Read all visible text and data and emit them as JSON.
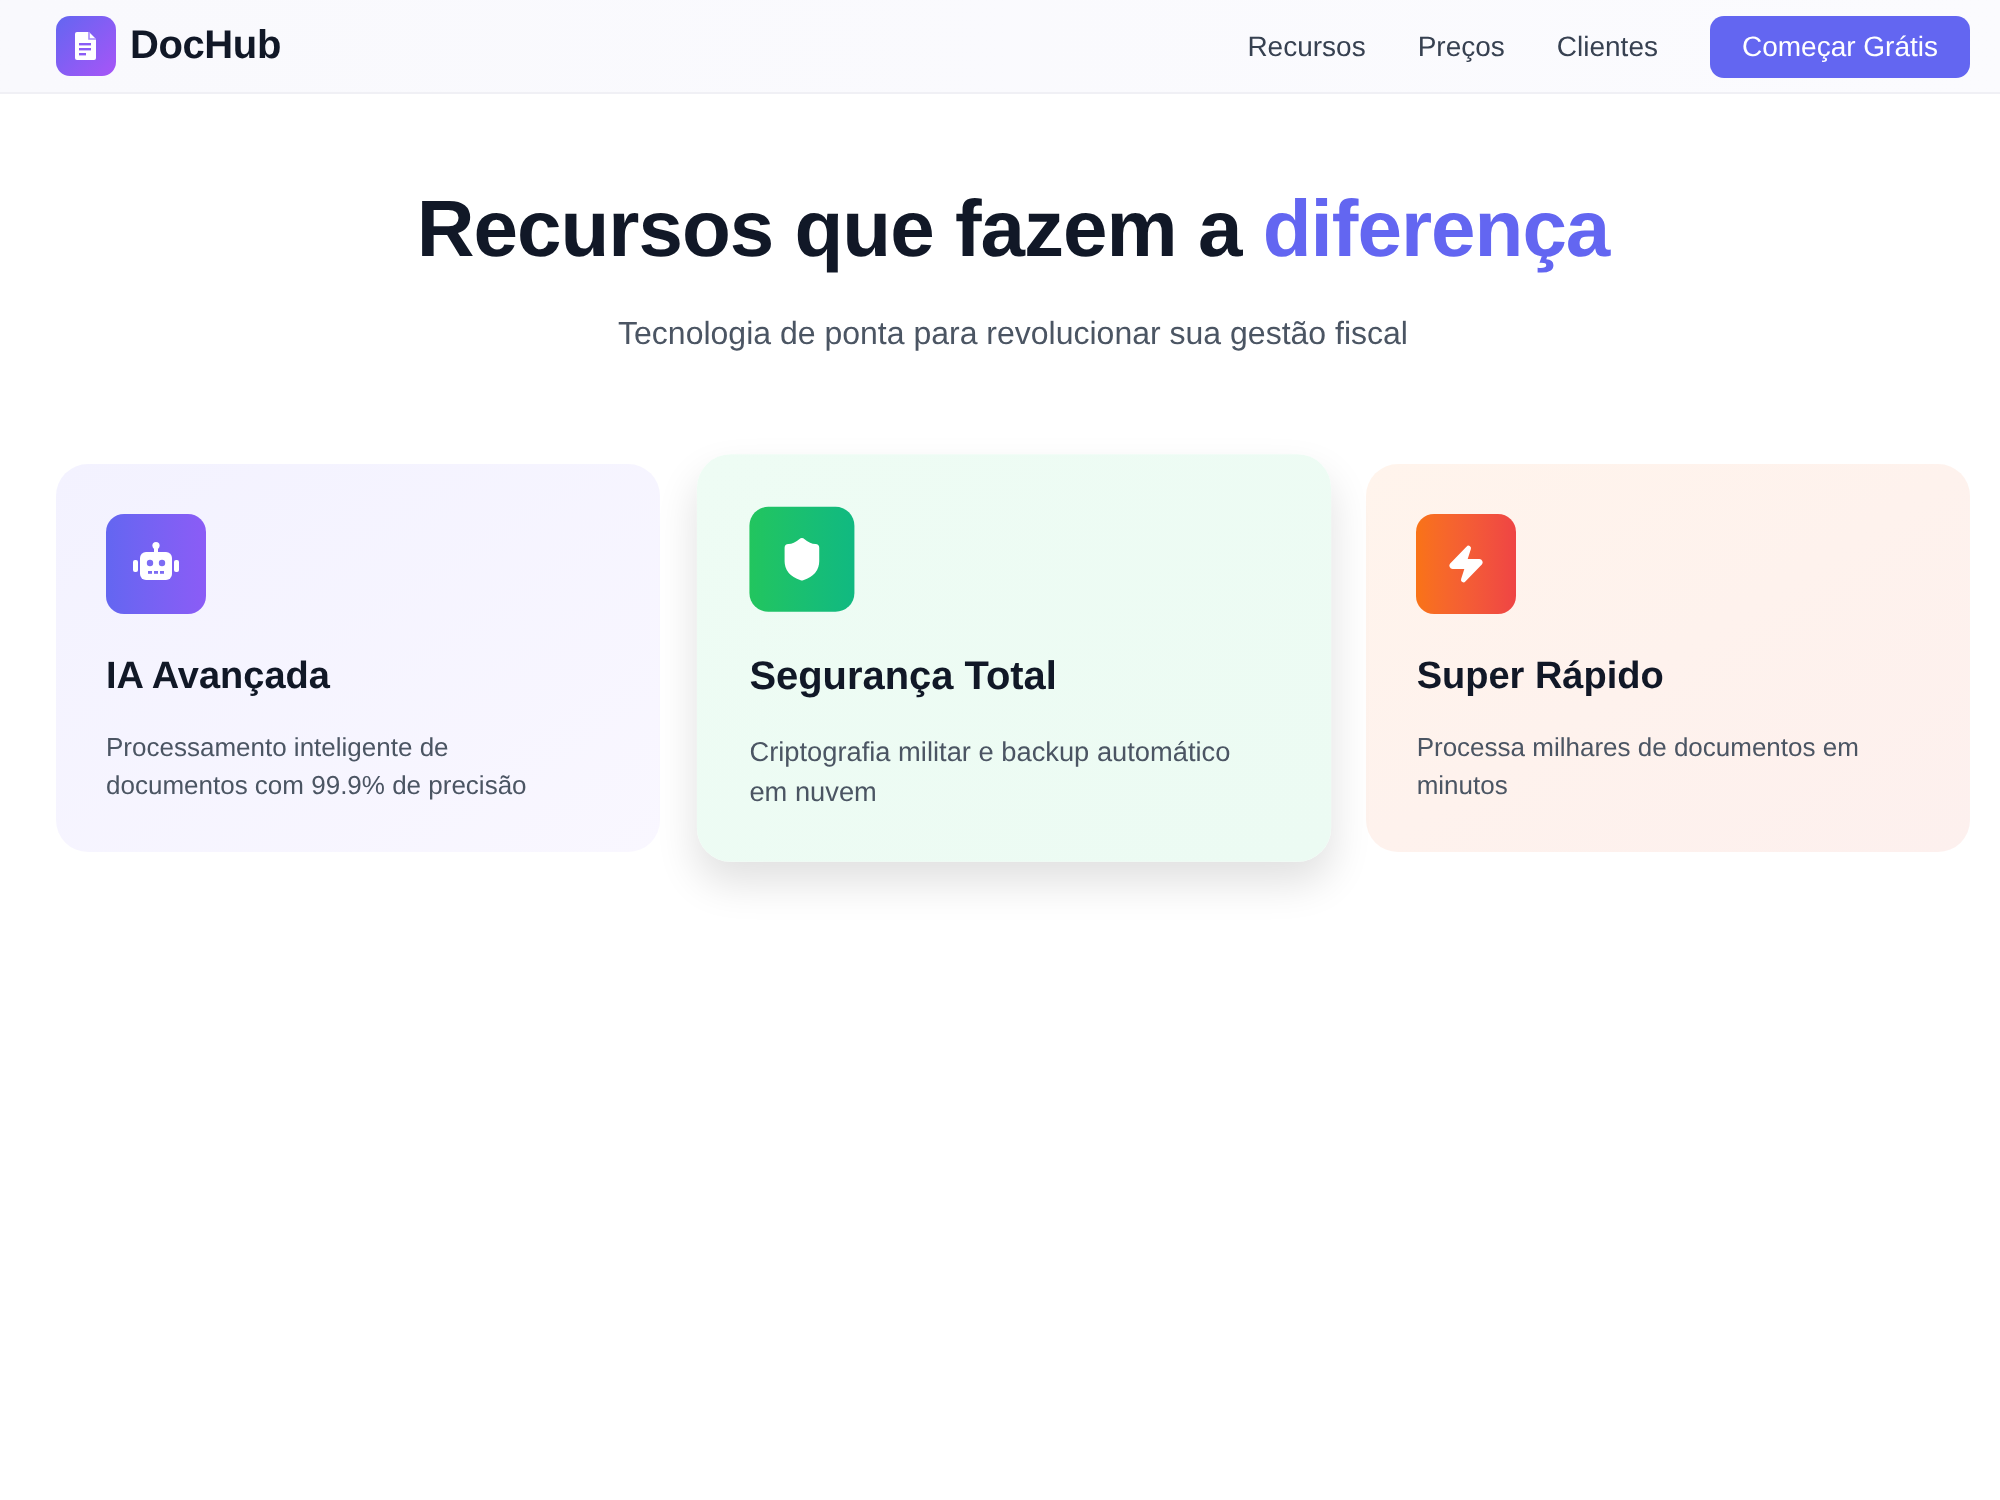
{
  "nav": {
    "brand": "DocHub",
    "links": [
      "Recursos",
      "Preços",
      "Clientes"
    ],
    "cta": "Começar Grátis"
  },
  "hero": {
    "title": "Recursos que fazem a",
    "title_highlight": "diferença",
    "subtitle": "Tecnologia de ponta para revolucionar sua gestão fiscal"
  },
  "features": [
    {
      "kind": "ai",
      "title": "IA Avançada",
      "description": "Processamento inteligente de documentos com 99.9% de precisão",
      "highlighted": false
    },
    {
      "kind": "security",
      "title": "Segurança Total",
      "description": "Criptografia militar e backup automático em nuvem",
      "highlighted": true
    },
    {
      "kind": "speed",
      "title": "Super Rápido",
      "description": "Processa milhares de documentos em minutos",
      "highlighted": false
    }
  ]
}
